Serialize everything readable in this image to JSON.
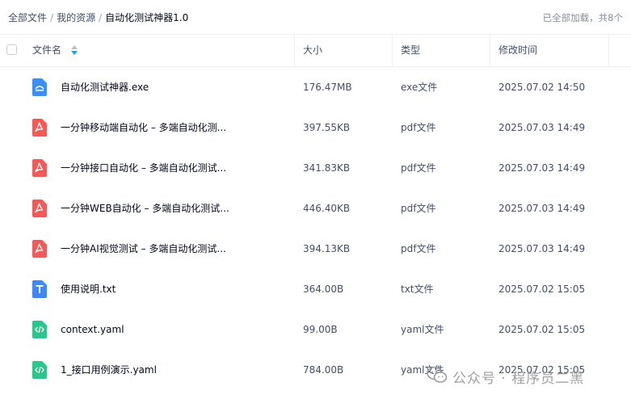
{
  "breadcrumb": {
    "root": "全部文件",
    "parent": "我的资源",
    "current": "自动化测试神器1.0",
    "separator": "/"
  },
  "load_status": "已全部加载，共8个",
  "columns": {
    "name": "文件名",
    "size": "大小",
    "type": "类型",
    "modified": "修改时间"
  },
  "files": [
    {
      "icon": "exe-file-icon",
      "name": "自动化测试神器.exe",
      "size": "176.47MB",
      "type": "exe文件",
      "modified": "2025.07.02 14:50"
    },
    {
      "icon": "pdf-file-icon",
      "name": "一分钟移动端自动化 – 多端自动化测...",
      "size": "397.55KB",
      "type": "pdf文件",
      "modified": "2025.07.03 14:49"
    },
    {
      "icon": "pdf-file-icon",
      "name": "一分钟接口自动化 – 多端自动化测试...",
      "size": "341.83KB",
      "type": "pdf文件",
      "modified": "2025.07.03 14:49"
    },
    {
      "icon": "pdf-file-icon",
      "name": "一分钟WEB自动化 – 多端自动化测试...",
      "size": "446.40KB",
      "type": "pdf文件",
      "modified": "2025.07.03 14:49"
    },
    {
      "icon": "pdf-file-icon",
      "name": "一分钟AI视觉测试 – 多端自动化测试...",
      "size": "394.13KB",
      "type": "pdf文件",
      "modified": "2025.07.03 14:49"
    },
    {
      "icon": "txt-file-icon",
      "name": "使用说明.txt",
      "size": "364.00B",
      "type": "txt文件",
      "modified": "2025.07.02 15:05"
    },
    {
      "icon": "yaml-file-icon",
      "name": "context.yaml",
      "size": "99.00B",
      "type": "yaml文件",
      "modified": "2025.07.02 15:05"
    },
    {
      "icon": "yaml-file-icon",
      "name": "1_接口用例演示.yaml",
      "size": "784.00B",
      "type": "yaml文件",
      "modified": "2025.07.02 15:05"
    }
  ],
  "watermark": {
    "text": "公众号 · 程序员二黑",
    "icon": "wechat-logo"
  },
  "colors": {
    "exe": "#3d8ef5",
    "pdf": "#f25a5a",
    "txt": "#3f87f5",
    "yaml": "#2dc48d",
    "sort_active": "#06a7ff"
  }
}
